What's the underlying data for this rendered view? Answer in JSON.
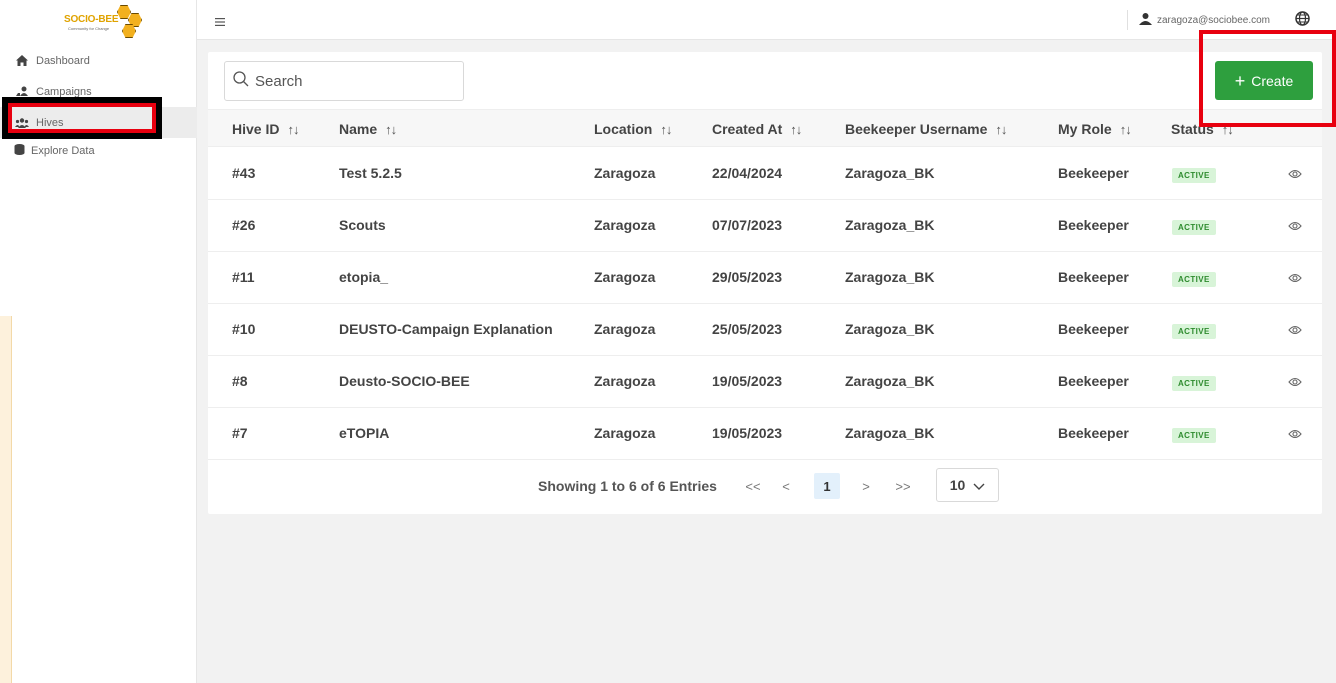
{
  "logo": {
    "wordmark": "SOCIO-BEE",
    "tagline": "Community for Change"
  },
  "sidebar": {
    "items": [
      {
        "label": "Dashboard",
        "icon": "home-icon"
      },
      {
        "label": "Campaigns",
        "icon": "campaigns-icon"
      },
      {
        "label": "Hives",
        "icon": "users-icon"
      },
      {
        "label": "Explore Data",
        "icon": "database-icon"
      }
    ]
  },
  "topbar": {
    "user_email": "zaragoza@sociobee.com"
  },
  "search": {
    "placeholder": "Search"
  },
  "create": {
    "label": "Create"
  },
  "table": {
    "columns": [
      "Hive ID",
      "Name",
      "Location",
      "Created At",
      "Beekeeper Username",
      "My Role",
      "Status"
    ],
    "rows": [
      {
        "id": "#43",
        "name": "Test 5.2.5",
        "location": "Zaragoza",
        "created": "22/04/2024",
        "beekeeper": "Zaragoza_BK",
        "role": "Beekeeper",
        "status": "ACTIVE"
      },
      {
        "id": "#26",
        "name": "Scouts",
        "location": "Zaragoza",
        "created": "07/07/2023",
        "beekeeper": "Zaragoza_BK",
        "role": "Beekeeper",
        "status": "ACTIVE"
      },
      {
        "id": "#11",
        "name": "etopia_",
        "location": "Zaragoza",
        "created": "29/05/2023",
        "beekeeper": "Zaragoza_BK",
        "role": "Beekeeper",
        "status": "ACTIVE"
      },
      {
        "id": "#10",
        "name": "DEUSTO-Campaign Explanation",
        "location": "Zaragoza",
        "created": "25/05/2023",
        "beekeeper": "Zaragoza_BK",
        "role": "Beekeeper",
        "status": "ACTIVE"
      },
      {
        "id": "#8",
        "name": "Deusto-SOCIO-BEE",
        "location": "Zaragoza",
        "created": "19/05/2023",
        "beekeeper": "Zaragoza_BK",
        "role": "Beekeeper",
        "status": "ACTIVE"
      },
      {
        "id": "#7",
        "name": "eTOPIA",
        "location": "Zaragoza",
        "created": "19/05/2023",
        "beekeeper": "Zaragoza_BK",
        "role": "Beekeeper",
        "status": "ACTIVE"
      }
    ]
  },
  "pagination": {
    "showing": "Showing 1 to 6 of 6 Entries",
    "first": "<<",
    "prev": "<",
    "current": "1",
    "next": ">",
    "last": ">>",
    "per_page": "10"
  },
  "colors": {
    "accent": "#2e9f3e",
    "highlight": "#e8000f",
    "badge_bg": "#d8f4d8",
    "badge_text": "#2e8b2e"
  }
}
